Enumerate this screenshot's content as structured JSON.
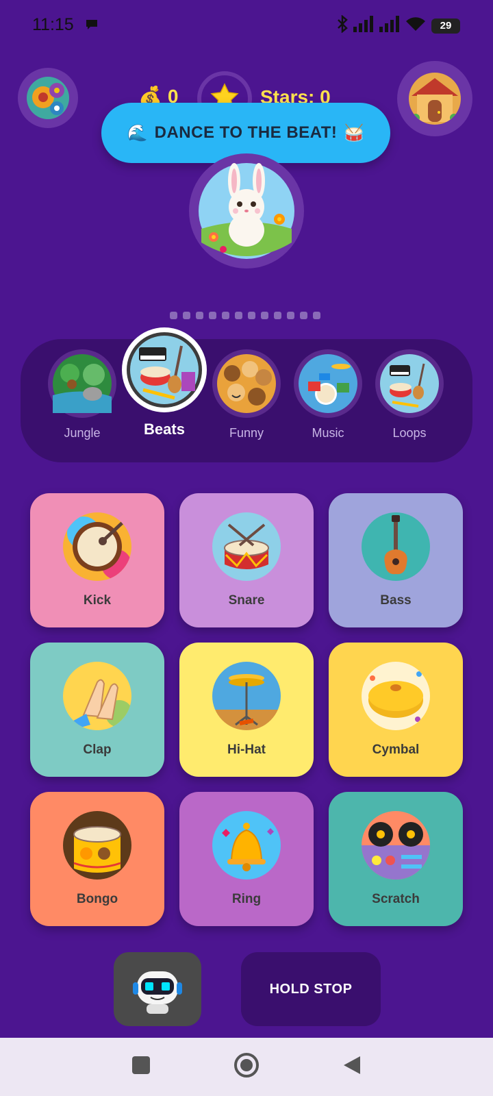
{
  "status": {
    "time": "11:15",
    "battery": "29"
  },
  "header": {
    "coins": "0",
    "stars_label": "Stars: 0"
  },
  "banner": {
    "text": "DANCE TO THE BEAT!",
    "lead_emoji": "🌊",
    "tail_emoji": "🥁"
  },
  "categories": [
    {
      "label": "Jungle",
      "active": false
    },
    {
      "label": "Beats",
      "active": true
    },
    {
      "label": "Funny",
      "active": false
    },
    {
      "label": "Music",
      "active": false
    },
    {
      "label": "Loops",
      "active": false
    }
  ],
  "pager": {
    "count": 12
  },
  "sounds": [
    {
      "name": "Kick",
      "color": "#f08fb6"
    },
    {
      "name": "Snare",
      "color": "#c98fdb"
    },
    {
      "name": "Bass",
      "color": "#9fa4dc"
    },
    {
      "name": "Clap",
      "color": "#7ecbc4"
    },
    {
      "name": "Hi-Hat",
      "color": "#ffeb6e"
    },
    {
      "name": "Cymbal",
      "color": "#ffd54f"
    },
    {
      "name": "Bongo",
      "color": "#ff8a65"
    },
    {
      "name": "Ring",
      "color": "#ba68c8"
    },
    {
      "name": "Scratch",
      "color": "#4db6ac"
    }
  ],
  "controls": {
    "stop_label": "HOLD STOP"
  }
}
